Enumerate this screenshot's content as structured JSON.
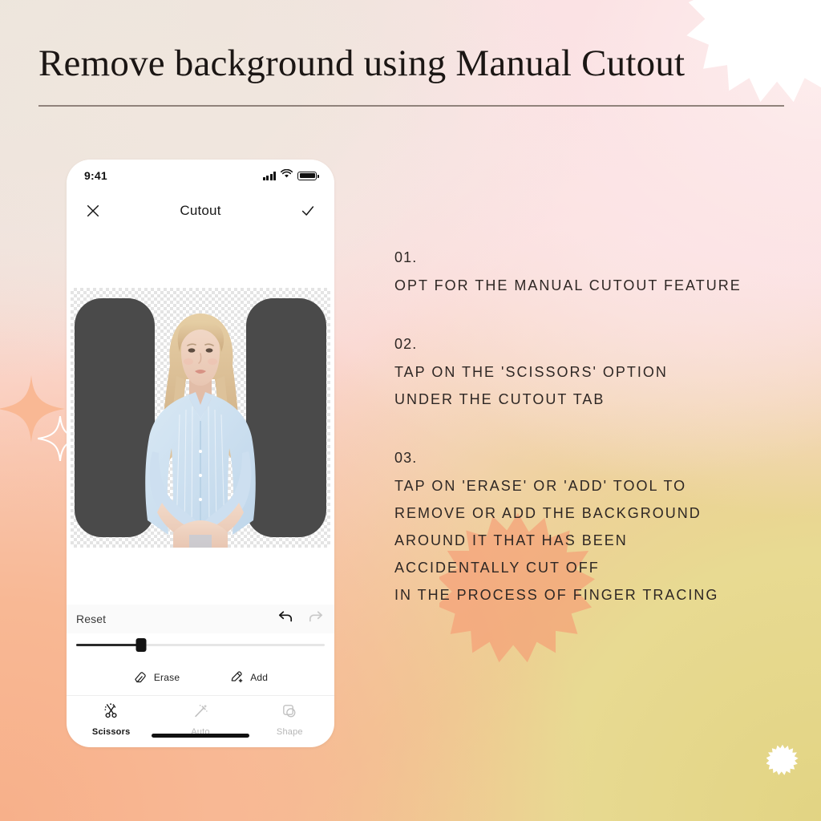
{
  "page": {
    "title": "Remove background using Manual Cutout",
    "background_colors": {
      "cream": "#EEE5DC",
      "pink": "#FBE3E4",
      "peach": "#F7B08A",
      "yellow": "#E2D483",
      "rule": "#8A7C75",
      "text": "#2E2724"
    }
  },
  "decor": {
    "top_right_burst": "sunburst-shape",
    "bottom_left_sparkle_filled": "sparkle-icon",
    "bottom_left_sparkle_outline": "sparkle-icon",
    "text_burst": "sunburst-shape",
    "bottom_right_burst": "sunburst-shape"
  },
  "steps": [
    {
      "number": "01.",
      "lines": [
        "OPT FOR THE MANUAL CUTOUT FEATURE"
      ]
    },
    {
      "number": "02.",
      "lines": [
        "TAP ON THE 'SCISSORS' OPTION",
        "UNDER THE CUTOUT TAB"
      ]
    },
    {
      "number": "03.",
      "lines": [
        "TAP ON 'ERASE' OR 'ADD' TOOL TO",
        "REMOVE OR ADD THE BACKGROUND",
        "AROUND IT THAT HAS BEEN",
        "ACCIDENTALLY CUT OFF",
        "IN THE PROCESS OF FINGER TRACING"
      ]
    }
  ],
  "phone": {
    "statusbar": {
      "time": "9:41",
      "cellular_icon": "signal-bars-icon",
      "wifi_icon": "wifi-icon",
      "battery_icon": "battery-icon"
    },
    "navbar": {
      "close_icon": "close-icon",
      "title": "Cutout",
      "confirm_icon": "check-icon"
    },
    "canvas": {
      "transparency_checker": "checkerboard-pattern",
      "subject": "woman-sitting-photo",
      "masked_region_color": "#4A4A4A"
    },
    "controls": {
      "reset_label": "Reset",
      "undo_icon": "undo-icon",
      "redo_icon": "redo-icon",
      "undo_enabled": true,
      "redo_enabled": false,
      "slider_value_percent": 26
    },
    "tools": [
      {
        "label": "Erase",
        "icon": "eraser-icon"
      },
      {
        "label": "Add",
        "icon": "pen-plus-icon"
      }
    ],
    "tabs": [
      {
        "label": "Scissors",
        "icon": "scissors-icon",
        "active": true
      },
      {
        "label": "Auto",
        "icon": "magic-wand-icon",
        "active": false
      },
      {
        "label": "Shape",
        "icon": "shapes-icon",
        "active": false
      }
    ],
    "home_indicator": "home-indicator"
  }
}
